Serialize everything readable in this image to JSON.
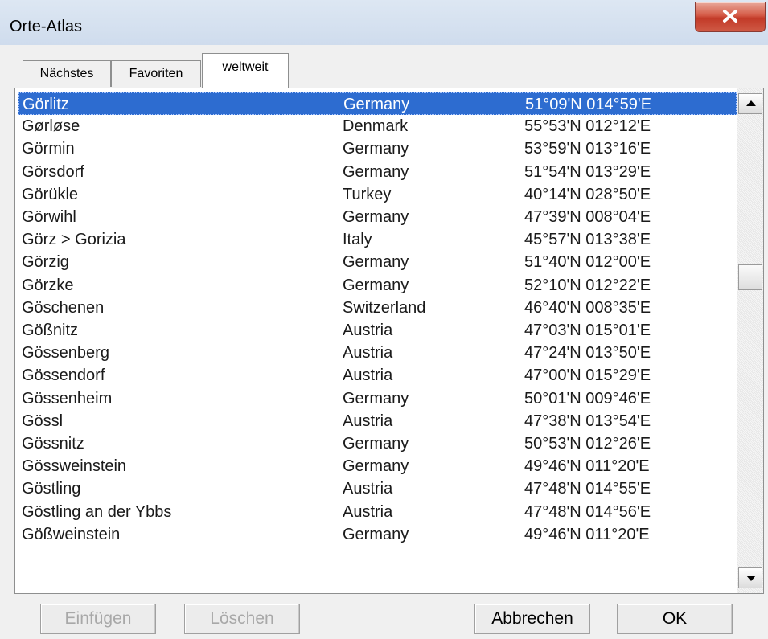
{
  "window": {
    "title": "Orte-Atlas"
  },
  "tabs": [
    {
      "label": "Nächstes"
    },
    {
      "label": "Favoriten"
    },
    {
      "label": "weltweit"
    }
  ],
  "list": {
    "selected_index": 0,
    "rows": [
      {
        "name": "Görlitz",
        "country": "Germany",
        "coord": "51°09'N 014°59'E"
      },
      {
        "name": "Gørløse",
        "country": "Denmark",
        "coord": "55°53'N 012°12'E"
      },
      {
        "name": "Görmin",
        "country": "Germany",
        "coord": "53°59'N 013°16'E"
      },
      {
        "name": "Görsdorf",
        "country": "Germany",
        "coord": "51°54'N 013°29'E"
      },
      {
        "name": "Görükle",
        "country": "Turkey",
        "coord": "40°14'N 028°50'E"
      },
      {
        "name": "Görwihl",
        "country": "Germany",
        "coord": "47°39'N 008°04'E"
      },
      {
        "name": "Görz > Gorizia",
        "country": "Italy",
        "coord": "45°57'N 013°38'E"
      },
      {
        "name": "Görzig",
        "country": "Germany",
        "coord": "51°40'N 012°00'E"
      },
      {
        "name": "Görzke",
        "country": "Germany",
        "coord": "52°10'N 012°22'E"
      },
      {
        "name": "Göschenen",
        "country": "Switzerland",
        "coord": "46°40'N 008°35'E"
      },
      {
        "name": "Gößnitz",
        "country": "Austria",
        "coord": "47°03'N 015°01'E"
      },
      {
        "name": "Gössenberg",
        "country": "Austria",
        "coord": "47°24'N 013°50'E"
      },
      {
        "name": "Gössendorf",
        "country": "Austria",
        "coord": "47°00'N 015°29'E"
      },
      {
        "name": "Gössenheim",
        "country": "Germany",
        "coord": "50°01'N 009°46'E"
      },
      {
        "name": "Gössl",
        "country": "Austria",
        "coord": "47°38'N 013°54'E"
      },
      {
        "name": "Gössnitz",
        "country": "Germany",
        "coord": "50°53'N 012°26'E"
      },
      {
        "name": "Gössweinstein",
        "country": "Germany",
        "coord": "49°46'N 011°20'E"
      },
      {
        "name": "Göstling",
        "country": "Austria",
        "coord": "47°48'N 014°55'E"
      },
      {
        "name": "Göstling an der Ybbs",
        "country": "Austria",
        "coord": "47°48'N 014°56'E"
      },
      {
        "name": "Gößweinstein",
        "country": "Germany",
        "coord": "49°46'N 011°20'E"
      }
    ]
  },
  "buttons": {
    "insert": "Einfügen",
    "delete": "Löschen",
    "cancel": "Abbrechen",
    "ok": "OK"
  },
  "colors": {
    "selection": "#2d6cd0",
    "close_button": "#c9452f"
  }
}
